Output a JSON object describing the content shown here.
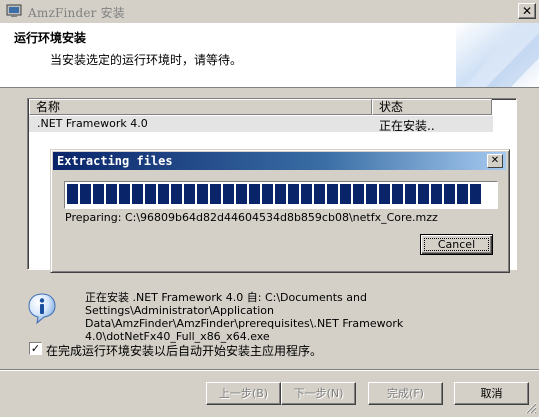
{
  "window": {
    "title": "AmzFinder 安装",
    "close_glyph": "✕",
    "icon": "installer-window-icon"
  },
  "header": {
    "title": "运行环境安装",
    "subtitle": "当安装选定的运行环境时，请等待。"
  },
  "list": {
    "columns": [
      "名称",
      "状态"
    ],
    "rows": [
      {
        "name": ".NET Framework 4.0",
        "status": "正在安装.."
      }
    ]
  },
  "extract_dialog": {
    "title": "Extracting files",
    "close_glyph": "✕",
    "progress": 0.98,
    "preparing_text": "Preparing: C:\\96809b64d82d44604534d8b859cb08\\netfx_Core.mzz",
    "cancel_label": "Cancel"
  },
  "info": {
    "icon": "info-icon",
    "text": "正在安装 .NET Framework 4.0 自: C:\\Documents and Settings\\Administrator\\Application Data\\AmzFinder\\AmzFinder\\prerequisites\\.NET Framework 4.0\\dotNetFx40_Full_x86_x64.exe"
  },
  "checkbox": {
    "checked": true,
    "label": "在完成运行环境安装以后自动开始安装主应用程序。"
  },
  "buttons": {
    "back": "上一步(B)",
    "next": "下一步(N)",
    "finish": "完成(F)",
    "cancel": "取消"
  },
  "colors": {
    "dialog_title_start": "#0a246a",
    "dialog_title_end": "#a6caf0",
    "progress_fill": "#0a246a",
    "face": "#d4d0c8"
  }
}
